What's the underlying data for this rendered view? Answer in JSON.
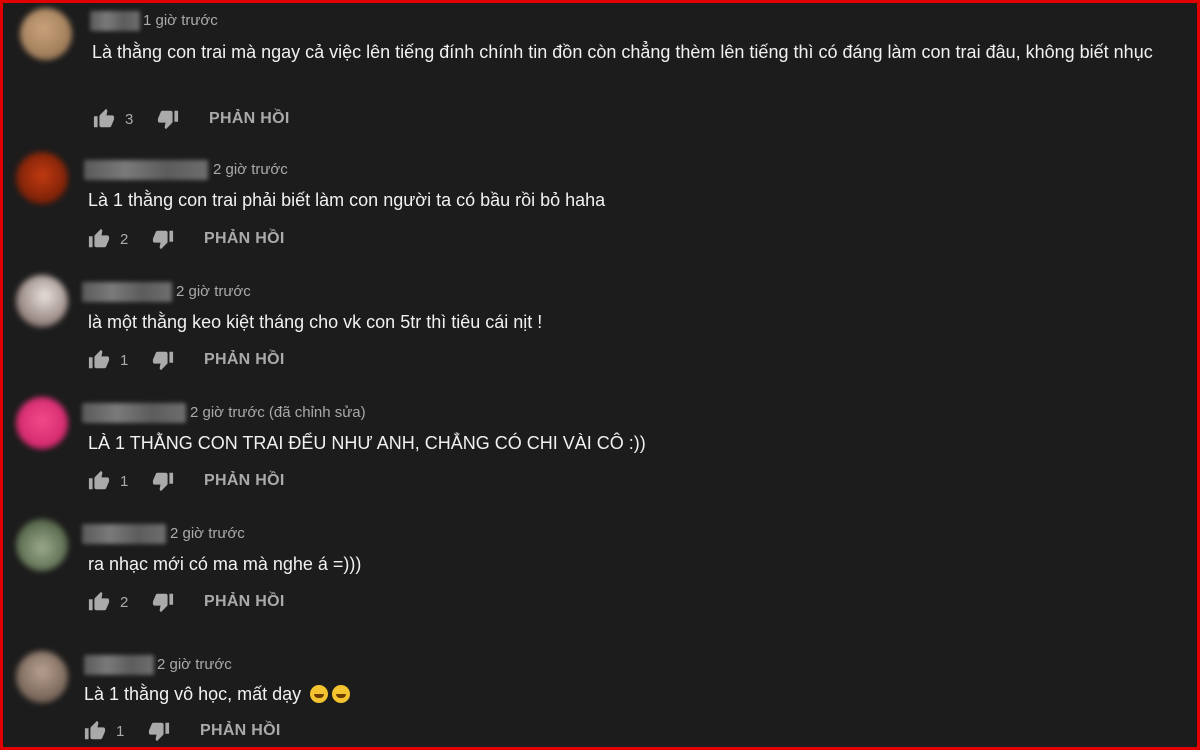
{
  "reply_label": "PHẢN HỒI",
  "icons": {
    "like": "thumbs-up-icon",
    "dislike": "thumbs-down-icon"
  },
  "colors": {
    "background": "#1c1c1c",
    "border": "#e00000",
    "meta": "#aaaaaa",
    "text": "#f1f1f1"
  },
  "comments": [
    {
      "time": "1 giờ trước",
      "text": "Là thằng con trai mà ngay cả việc lên tiếng đính chính tin đồn còn chẳng thèm lên tiếng thì có đáng làm con trai đâu, không biết nhục",
      "likes": "3"
    },
    {
      "time": "2 giờ trước",
      "text": "Là 1 thằng con trai phải biết làm con người ta có bầu rồi bỏ haha",
      "likes": "2"
    },
    {
      "time": "2 giờ trước",
      "text": "là một thằng keo kiệt tháng cho vk con 5tr thì tiêu cái nịt !",
      "likes": "1"
    },
    {
      "time": "2 giờ trước (đã chỉnh sửa)",
      "text": "LÀ 1 THẰNG CON TRAI ĐỂU NHƯ ANH, CHẲNG CÓ CHI VÀI CÔ :))",
      "likes": "1"
    },
    {
      "time": "2 giờ trước",
      "text": "ra nhạc mới có ma mà nghe á =)))",
      "likes": "2"
    },
    {
      "time": "2 giờ trước",
      "text": "Là 1 thằng vô học, mất dạy",
      "likes": "1"
    }
  ]
}
